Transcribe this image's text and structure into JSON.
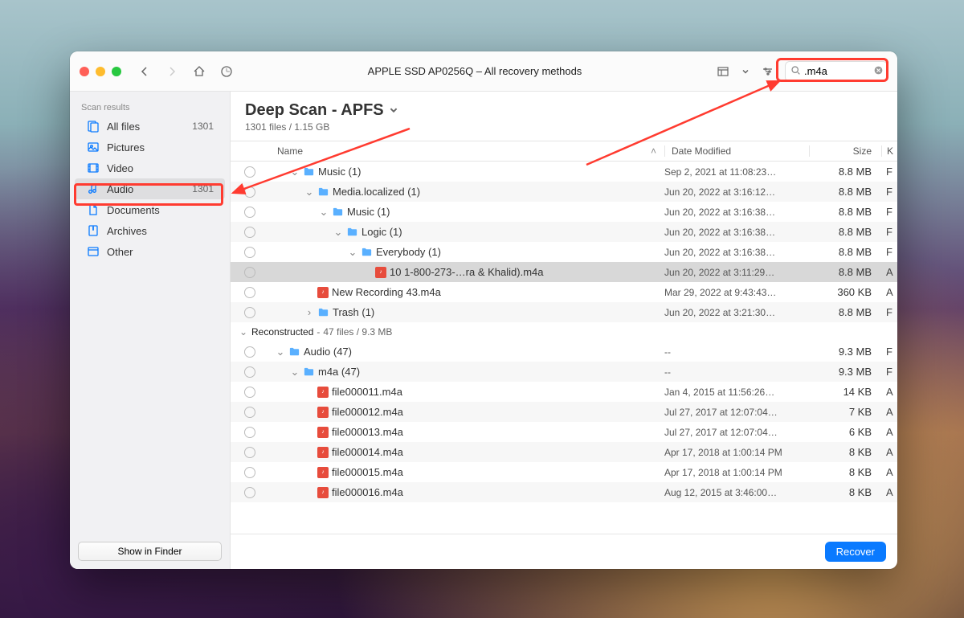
{
  "toolbar": {
    "title": "APPLE SSD AP0256Q – All recovery methods",
    "search_value": ".m4a"
  },
  "sidebar": {
    "header": "Scan results",
    "items": [
      {
        "icon": "files-icon",
        "label": "All files",
        "count": "1301"
      },
      {
        "icon": "pictures-icon",
        "label": "Pictures",
        "count": ""
      },
      {
        "icon": "video-icon",
        "label": "Video",
        "count": ""
      },
      {
        "icon": "audio-icon",
        "label": "Audio",
        "count": "1301",
        "selected": true
      },
      {
        "icon": "documents-icon",
        "label": "Documents",
        "count": ""
      },
      {
        "icon": "archives-icon",
        "label": "Archives",
        "count": ""
      },
      {
        "icon": "other-icon",
        "label": "Other",
        "count": ""
      }
    ],
    "footer_button": "Show in Finder"
  },
  "main": {
    "title": "Deep Scan - APFS",
    "subtitle": "1301 files / 1.15 GB",
    "columns": {
      "name": "Name",
      "date": "Date Modified",
      "size": "Size",
      "kind": "K"
    },
    "group2": {
      "name": "Reconstructed",
      "detail": "47 files / 9.3 MB"
    },
    "rows": [
      {
        "indent": 2,
        "type": "folder",
        "disc": "v",
        "name": "Music (1)",
        "date": "Sep 2, 2021 at 11:08:23…",
        "size": "8.8 MB",
        "kind": "F"
      },
      {
        "indent": 3,
        "type": "folder",
        "disc": "v",
        "name": "Media.localized (1)",
        "date": "Jun 20, 2022 at 3:16:12…",
        "size": "8.8 MB",
        "kind": "F"
      },
      {
        "indent": 4,
        "type": "folder",
        "disc": "v",
        "name": "Music (1)",
        "date": "Jun 20, 2022 at 3:16:38…",
        "size": "8.8 MB",
        "kind": "F"
      },
      {
        "indent": 5,
        "type": "folder",
        "disc": "v",
        "name": "Logic (1)",
        "date": "Jun 20, 2022 at 3:16:38…",
        "size": "8.8 MB",
        "kind": "F"
      },
      {
        "indent": 6,
        "type": "folder",
        "disc": "v",
        "name": "Everybody (1)",
        "date": "Jun 20, 2022 at 3:16:38…",
        "size": "8.8 MB",
        "kind": "F"
      },
      {
        "indent": 7,
        "type": "m4a",
        "disc": "",
        "name": "10 1-800-273-…ra & Khalid).m4a",
        "date": "Jun 20, 2022 at 3:11:29…",
        "size": "8.8 MB",
        "kind": "A",
        "selected": true
      },
      {
        "indent": 3,
        "type": "m4a",
        "disc": "",
        "name": "New Recording 43.m4a",
        "date": "Mar 29, 2022 at 9:43:43…",
        "size": "360 KB",
        "kind": "A"
      },
      {
        "indent": 3,
        "type": "folder",
        "disc": ">",
        "name": "Trash (1)",
        "date": "Jun 20, 2022 at 3:21:30…",
        "size": "8.8 MB",
        "kind": "F"
      }
    ],
    "rows2": [
      {
        "indent": 1,
        "type": "folder",
        "disc": "v",
        "name": "Audio (47)",
        "date": "--",
        "size": "9.3 MB",
        "kind": "F"
      },
      {
        "indent": 2,
        "type": "folder",
        "disc": "v",
        "name": "m4a (47)",
        "date": "--",
        "size": "9.3 MB",
        "kind": "F"
      },
      {
        "indent": 3,
        "type": "m4a",
        "disc": "",
        "name": "file000011.m4a",
        "date": "Jan 4, 2015 at 11:56:26…",
        "size": "14 KB",
        "kind": "A"
      },
      {
        "indent": 3,
        "type": "m4a",
        "disc": "",
        "name": "file000012.m4a",
        "date": "Jul 27, 2017 at 12:07:04…",
        "size": "7 KB",
        "kind": "A"
      },
      {
        "indent": 3,
        "type": "m4a",
        "disc": "",
        "name": "file000013.m4a",
        "date": "Jul 27, 2017 at 12:07:04…",
        "size": "6 KB",
        "kind": "A"
      },
      {
        "indent": 3,
        "type": "m4a",
        "disc": "",
        "name": "file000014.m4a",
        "date": "Apr 17, 2018 at 1:00:14 PM",
        "size": "8 KB",
        "kind": "A"
      },
      {
        "indent": 3,
        "type": "m4a",
        "disc": "",
        "name": "file000015.m4a",
        "date": "Apr 17, 2018 at 1:00:14 PM",
        "size": "8 KB",
        "kind": "A"
      },
      {
        "indent": 3,
        "type": "m4a",
        "disc": "",
        "name": "file000016.m4a",
        "date": "Aug 12, 2015 at 3:46:00…",
        "size": "8 KB",
        "kind": "A"
      }
    ]
  },
  "footer": {
    "recover": "Recover"
  }
}
